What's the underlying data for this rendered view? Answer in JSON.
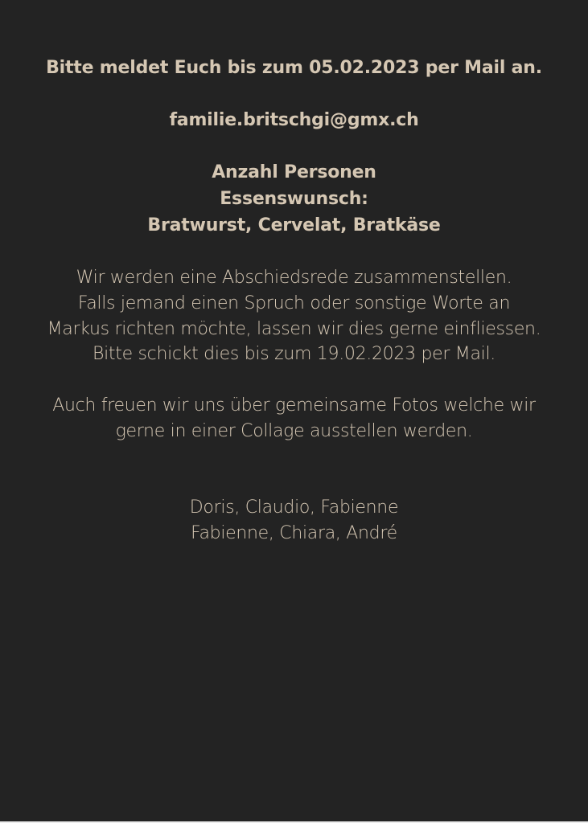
{
  "rsvp": {
    "deadline_line": "Bitte meldet Euch bis zum 05.02.2023 per Mail an.",
    "email": "familie.britschgi@gmx.ch"
  },
  "requirements": {
    "count_label": "Anzahl Personen",
    "food_label": "Essenswunsch:",
    "food_options": "Bratwurst, Cervelat, Bratkäse"
  },
  "speech": {
    "lines": [
      "Wir werden eine Abschiedsrede zusammenstellen.",
      "Falls jemand einen Spruch oder sonstige Worte an",
      "Markus richten möchte, lassen wir dies gerne einfliessen.",
      "Bitte schickt dies bis zum 19.02.2023 per Mail."
    ]
  },
  "photos": {
    "lines": [
      "Auch freuen wir uns über gemeinsame Fotos welche wir",
      "gerne in einer Collage ausstellen werden."
    ]
  },
  "signatures": {
    "lines": [
      "Doris, Claudio, Fabienne",
      "Fabienne, Chiara, André"
    ]
  }
}
